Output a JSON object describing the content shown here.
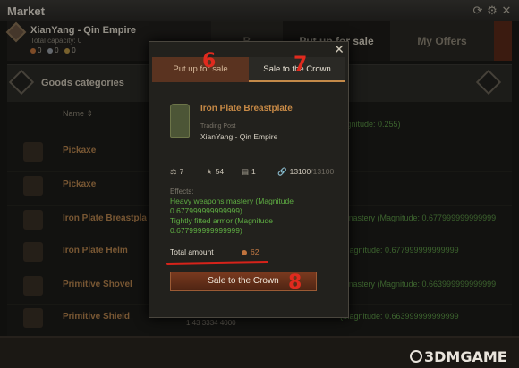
{
  "window": {
    "title": "Market"
  },
  "estate": {
    "name": "XianYang - Qin Empire",
    "capacity": "Total capacity: 0",
    "coins": [
      "0",
      "0",
      "0"
    ],
    "coin_colors": [
      "#c0733d",
      "#9aa0a8",
      "#b99545"
    ]
  },
  "main_tabs": {
    "buy": "B",
    "put_up": "Put up for sale",
    "my_offers": "My Offers"
  },
  "categories": {
    "label": "Goods categories"
  },
  "list": {
    "column_name": "Name",
    "top_effect": "(Magnitude: 0.255)",
    "rows": [
      {
        "name": "Pickaxe",
        "stat": "",
        "nums": ""
      },
      {
        "name": "Pickaxe",
        "stat": "",
        "nums": ""
      },
      {
        "name": "Iron Plate Breastpla",
        "stat": "s mastery (Magnitude: 0.677999999999999",
        "nums": ""
      },
      {
        "name": "Iron Plate Helm",
        "stat": "(Magnitude: 0.677999999999999",
        "nums": ""
      },
      {
        "name": "Primitive Shovel",
        "stat": "s mastery (Magnitude: 0.663999999999999",
        "nums": ""
      },
      {
        "name": "Primitive Shield",
        "stat": "(Magnitude: 0.663999999999999",
        "nums": "1     43     3334 4000"
      }
    ]
  },
  "modal": {
    "tabs": {
      "put_up": "Put up for sale",
      "crown": "Sale to the Crown"
    },
    "item": {
      "name": "Iron Plate Breastplate",
      "source": "Trading Post",
      "location": "XianYang - Qin Empire"
    },
    "stats": {
      "weight": "7",
      "quality": "54",
      "quantity": "1",
      "durability": "13100",
      "durability_max": "/13100"
    },
    "effects_title": "Effects:",
    "effects": [
      "Heavy weapons mastery (Magnitude 0.677999999999999)",
      "Tightly fitted armor (Magnitude 0.677999999999999)"
    ],
    "total_label": "Total amount",
    "total_value": "62",
    "sale_button": "Sale to the Crown"
  },
  "annotations": {
    "a6": "6",
    "a7": "7",
    "a8": "8"
  },
  "watermark": {
    "text": "3DMGAME"
  }
}
